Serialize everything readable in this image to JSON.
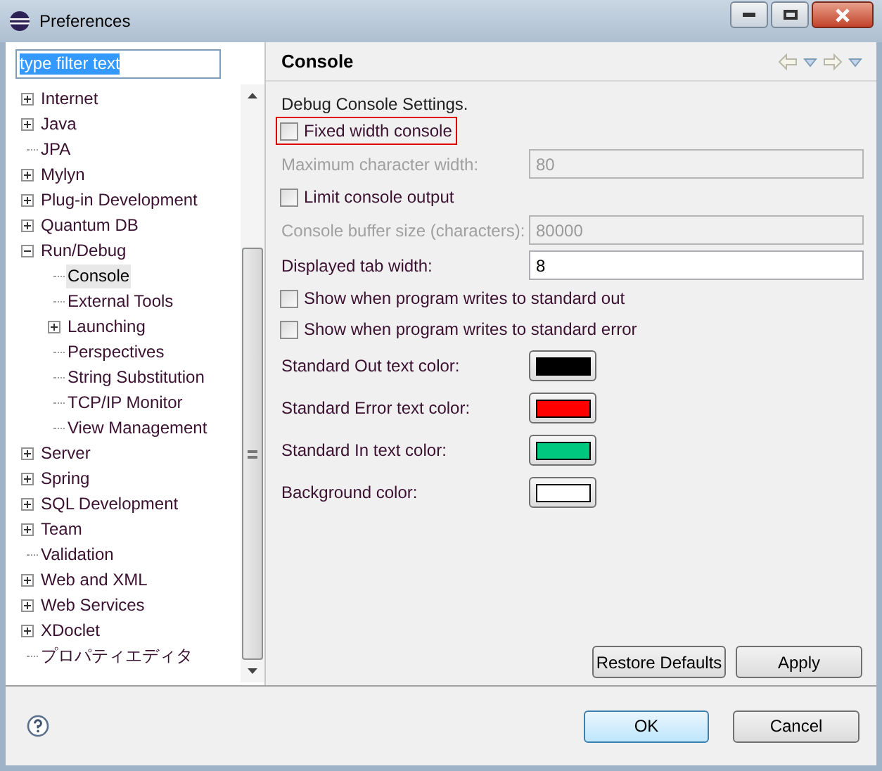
{
  "window": {
    "title": "Preferences"
  },
  "filter": {
    "value": "type filter text"
  },
  "tree": [
    {
      "label": "Internet",
      "kind": "group",
      "expanded": false,
      "selected": false
    },
    {
      "label": "Java",
      "kind": "group",
      "expanded": false,
      "selected": false
    },
    {
      "label": "JPA",
      "kind": "page",
      "selected": false
    },
    {
      "label": "Mylyn",
      "kind": "group",
      "expanded": false,
      "selected": false
    },
    {
      "label": "Plug-in Development",
      "kind": "group",
      "expanded": false,
      "selected": false
    },
    {
      "label": "Quantum DB",
      "kind": "group",
      "expanded": false,
      "selected": false
    },
    {
      "label": "Run/Debug",
      "kind": "group",
      "expanded": true,
      "selected": false,
      "children": [
        {
          "label": "Console",
          "kind": "page",
          "selected": true
        },
        {
          "label": "External Tools",
          "kind": "page",
          "selected": false
        },
        {
          "label": "Launching",
          "kind": "group",
          "expanded": false,
          "selected": false
        },
        {
          "label": "Perspectives",
          "kind": "page",
          "selected": false
        },
        {
          "label": "String Substitution",
          "kind": "page",
          "selected": false
        },
        {
          "label": "TCP/IP Monitor",
          "kind": "page",
          "selected": false
        },
        {
          "label": "View Management",
          "kind": "page",
          "selected": false
        }
      ]
    },
    {
      "label": "Server",
      "kind": "group",
      "expanded": false,
      "selected": false
    },
    {
      "label": "Spring",
      "kind": "group",
      "expanded": false,
      "selected": false
    },
    {
      "label": "SQL Development",
      "kind": "group",
      "expanded": false,
      "selected": false
    },
    {
      "label": "Team",
      "kind": "group",
      "expanded": false,
      "selected": false
    },
    {
      "label": "Validation",
      "kind": "page",
      "selected": false
    },
    {
      "label": "Web and XML",
      "kind": "group",
      "expanded": false,
      "selected": false
    },
    {
      "label": "Web Services",
      "kind": "group",
      "expanded": false,
      "selected": false
    },
    {
      "label": "XDoclet",
      "kind": "group",
      "expanded": false,
      "selected": false
    },
    {
      "label": "プロパティエディタ",
      "kind": "page",
      "selected": false
    }
  ],
  "page": {
    "title": "Console",
    "rows": [
      {
        "kind": "text",
        "label": "Debug Console Settings."
      },
      {
        "kind": "checkbox",
        "label": "Fixed width console",
        "checked": false,
        "highlighted": true
      },
      {
        "kind": "field",
        "label": "Maximum character width:",
        "value": "80",
        "disabled": true
      },
      {
        "kind": "checkbox",
        "label": "Limit console output",
        "checked": false,
        "highlighted": false
      },
      {
        "kind": "field",
        "label": "Console buffer size (characters):",
        "value": "80000",
        "disabled": true
      },
      {
        "kind": "field",
        "label": "Displayed tab width:",
        "value": "8",
        "disabled": false
      },
      {
        "kind": "checkbox",
        "label": "Show when program writes to standard out",
        "checked": false,
        "highlighted": false
      },
      {
        "kind": "checkbox",
        "label": "Show when program writes to standard error",
        "checked": false,
        "highlighted": false
      },
      {
        "kind": "color",
        "label": "Standard Out text color:",
        "color": "#000000"
      },
      {
        "kind": "color",
        "label": "Standard Error text color:",
        "color": "#ff0000"
      },
      {
        "kind": "color",
        "label": "Standard In text color:",
        "color": "#00c87f"
      },
      {
        "kind": "color",
        "label": "Background color:",
        "color": "#ffffff"
      }
    ],
    "buttons": [
      "Restore Defaults",
      "Apply"
    ]
  },
  "footer": {
    "buttons": [
      "OK",
      "Cancel"
    ]
  }
}
